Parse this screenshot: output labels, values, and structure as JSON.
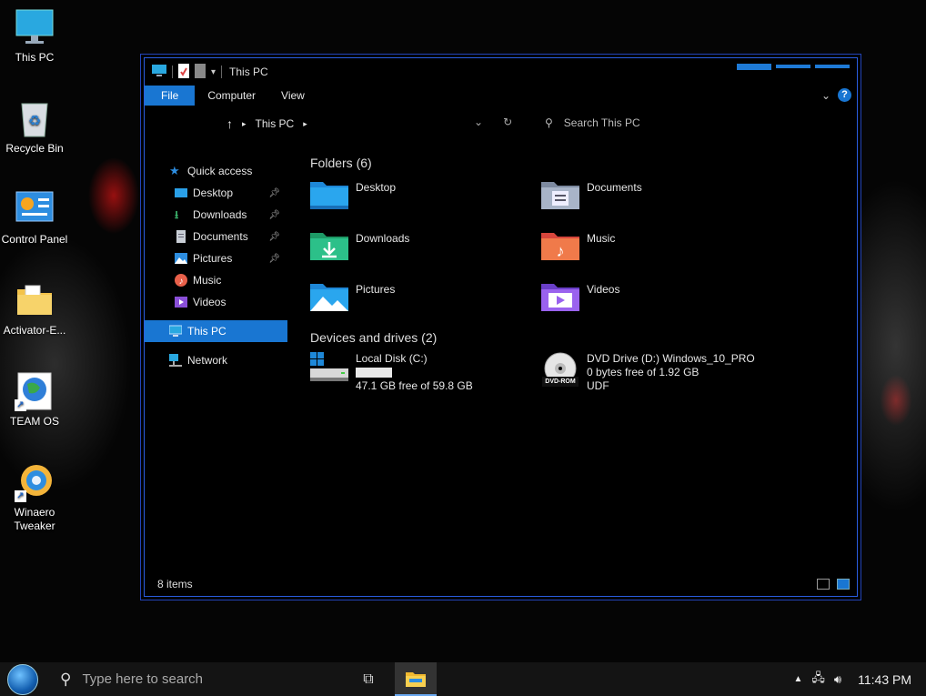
{
  "desktop": {
    "icons": [
      {
        "label": "This PC",
        "icon": "monitor-icon"
      },
      {
        "label": "Recycle Bin",
        "icon": "recycle-bin-icon"
      },
      {
        "label": "Control Panel",
        "icon": "control-panel-icon"
      },
      {
        "label": "Activator-E...",
        "icon": "folder-icon"
      },
      {
        "label": "TEAM OS",
        "icon": "globe-shortcut-icon"
      },
      {
        "label": "Winaero Tweaker",
        "icon": "winaero-shortcut-icon"
      }
    ]
  },
  "window": {
    "title": "This PC",
    "ribbon": {
      "file": "File",
      "computer": "Computer",
      "view": "View",
      "help": "?"
    },
    "address": {
      "location": "This PC",
      "search_placeholder": "Search This PC"
    },
    "nav": {
      "quick_access": "Quick access",
      "items": [
        {
          "label": "Desktop",
          "icon": "desktop-folder-icon"
        },
        {
          "label": "Downloads",
          "icon": "download-icon"
        },
        {
          "label": "Documents",
          "icon": "document-icon"
        },
        {
          "label": "Pictures",
          "icon": "pictures-icon"
        },
        {
          "label": "Music",
          "icon": "music-icon"
        },
        {
          "label": "Videos",
          "icon": "video-icon"
        }
      ],
      "this_pc": "This PC",
      "network": "Network"
    },
    "folders": {
      "header": "Folders (6)",
      "items": [
        "Desktop",
        "Documents",
        "Downloads",
        "Music",
        "Pictures",
        "Videos"
      ]
    },
    "drives": {
      "header": "Devices and drives (2)",
      "items": [
        {
          "name": "Local Disk (C:)",
          "free": "47.1 GB free of 59.8 GB",
          "used_fraction": 0.21
        },
        {
          "name": "DVD Drive (D:) Windows_10_PRO",
          "free": "0 bytes free of 1.92 GB",
          "fs": "UDF",
          "badge": "DVD-ROM"
        }
      ]
    },
    "status": "8 items"
  },
  "taskbar": {
    "search_placeholder": "Type here to search",
    "clock": "11:43 PM"
  },
  "colors": {
    "accent": "#1976d2"
  }
}
